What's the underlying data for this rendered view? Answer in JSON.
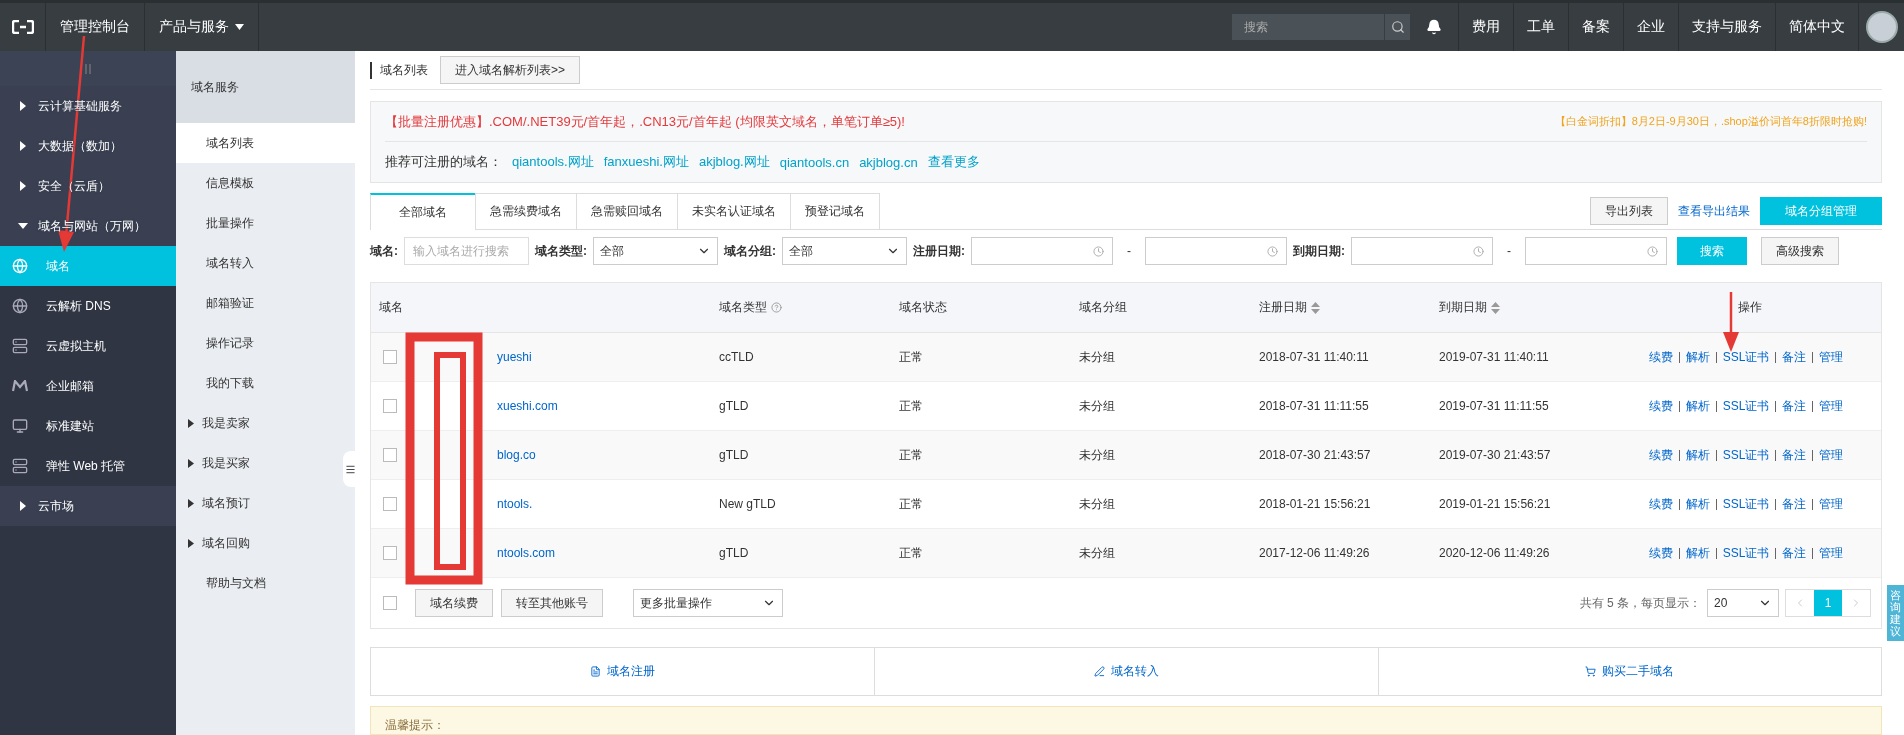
{
  "topbar": {
    "nav": [
      {
        "label": "管理控制台",
        "dropdown": false
      },
      {
        "label": "产品与服务",
        "dropdown": true
      }
    ],
    "search": {
      "placeholder": "搜索"
    },
    "links": [
      "费用",
      "工单",
      "备案",
      "企业",
      "支持与服务",
      "简体中文"
    ]
  },
  "sidebar": {
    "items": [
      {
        "label": "云计算基础服务",
        "kind": "group",
        "expanded": false
      },
      {
        "label": "大数据（数加）",
        "kind": "group",
        "expanded": false
      },
      {
        "label": "安全（云盾）",
        "kind": "group",
        "expanded": false
      },
      {
        "label": "域名与网站（万网）",
        "kind": "group",
        "expanded": true
      },
      {
        "label": "域名",
        "kind": "service",
        "selected": true
      },
      {
        "label": "云解析 DNS",
        "kind": "service",
        "selected": false
      },
      {
        "label": "云虚拟主机",
        "kind": "service",
        "selected": false
      },
      {
        "label": "企业邮箱",
        "kind": "service",
        "selected": false
      },
      {
        "label": "标准建站",
        "kind": "service",
        "selected": false
      },
      {
        "label": "弹性 Web 托管",
        "kind": "service",
        "selected": false
      },
      {
        "label": "云市场",
        "kind": "group",
        "expanded": false
      }
    ]
  },
  "subnav": {
    "title": "域名服务",
    "items": [
      {
        "label": "域名列表",
        "selected": true,
        "expandable": false
      },
      {
        "label": "信息模板",
        "selected": false,
        "expandable": false
      },
      {
        "label": "批量操作",
        "selected": false,
        "expandable": false
      },
      {
        "label": "域名转入",
        "selected": false,
        "expandable": false
      },
      {
        "label": "邮箱验证",
        "selected": false,
        "expandable": false
      },
      {
        "label": "操作记录",
        "selected": false,
        "expandable": false
      },
      {
        "label": "我的下载",
        "selected": false,
        "expandable": false
      },
      {
        "label": "我是卖家",
        "selected": false,
        "expandable": true
      },
      {
        "label": "我是买家",
        "selected": false,
        "expandable": true
      },
      {
        "label": "域名预订",
        "selected": false,
        "expandable": true
      },
      {
        "label": "域名回购",
        "selected": false,
        "expandable": true
      },
      {
        "label": "帮助与文档",
        "selected": false,
        "expandable": false
      }
    ]
  },
  "header": {
    "title": "域名列表",
    "button": "进入域名解析列表>>"
  },
  "promo": {
    "headline": "【批量注册优惠】.COM/.NET39元/首年起，.CN13元/首年起 (均限英文域名，单笔订单≥5)!",
    "side_note": "【白金词折扣】8月2日-9月30日，.shop溢价词首年8折限时抢购!",
    "recommend_label": "推荐可注册的域名：",
    "suggestions": [
      "qiantools.网址",
      "fanxueshi.网址",
      "akjblog.网址",
      "qiantools.cn",
      "akjblog.cn"
    ],
    "more": "查看更多"
  },
  "tabs": [
    {
      "label": "全部域名",
      "selected": true
    },
    {
      "label": "急需续费域名",
      "selected": false
    },
    {
      "label": "急需赎回域名",
      "selected": false
    },
    {
      "label": "未实名认证域名",
      "selected": false
    },
    {
      "label": "预登记域名",
      "selected": false
    }
  ],
  "tab_actions": {
    "export": "导出列表",
    "view_results": "查看导出结果",
    "group_manage": "域名分组管理"
  },
  "filters": [
    {
      "label": "域名:",
      "kind": "text",
      "placeholder": "输入域名进行搜索"
    },
    {
      "label": "域名类型:",
      "kind": "select",
      "value": "全部"
    },
    {
      "label": "域名分组:",
      "kind": "select",
      "value": "全部"
    },
    {
      "label": "注册日期:",
      "kind": "daterange",
      "separator": "-"
    },
    {
      "label": "到期日期:",
      "kind": "daterange",
      "separator": "-"
    }
  ],
  "search_button": "搜索",
  "advanced_button": "高级搜索",
  "table": {
    "columns": [
      {
        "label": "域名",
        "sortable": false,
        "help": false
      },
      {
        "label": "域名类型",
        "sortable": false,
        "help": true
      },
      {
        "label": "域名状态",
        "sortable": false,
        "help": false
      },
      {
        "label": "域名分组",
        "sortable": false,
        "help": false
      },
      {
        "label": "注册日期",
        "sortable": true,
        "help": false
      },
      {
        "label": "到期日期",
        "sortable": true,
        "help": false
      },
      {
        "label": "操作",
        "sortable": false,
        "help": false
      }
    ],
    "rows": [
      {
        "checked": false,
        "domain": "yueshi",
        "type": "ccTLD",
        "status": "正常",
        "group": "未分组",
        "registered": "2018-07-31 11:40:11",
        "expires": "2019-07-31 11:40:11",
        "actions": [
          "续费",
          "解析",
          "SSL证书",
          "备注",
          "管理"
        ]
      },
      {
        "checked": false,
        "domain": "xueshi.com",
        "type": "gTLD",
        "status": "正常",
        "group": "未分组",
        "registered": "2018-07-31 11:11:55",
        "expires": "2019-07-31 11:11:55",
        "actions": [
          "续费",
          "解析",
          "SSL证书",
          "备注",
          "管理"
        ]
      },
      {
        "checked": false,
        "domain": "blog.co",
        "type": "gTLD",
        "status": "正常",
        "group": "未分组",
        "registered": "2018-07-30 21:43:57",
        "expires": "2019-07-30 21:43:57",
        "actions": [
          "续费",
          "解析",
          "SSL证书",
          "备注",
          "管理"
        ]
      },
      {
        "checked": false,
        "domain": "ntools.",
        "type": "New gTLD",
        "status": "正常",
        "group": "未分组",
        "registered": "2018-01-21 15:56:21",
        "expires": "2019-01-21 15:56:21",
        "actions": [
          "续费",
          "解析",
          "SSL证书",
          "备注",
          "管理"
        ]
      },
      {
        "checked": false,
        "domain": "ntools.com",
        "type": "gTLD",
        "status": "正常",
        "group": "未分组",
        "registered": "2017-12-06 11:49:26",
        "expires": "2020-12-06 11:49:26",
        "actions": [
          "续费",
          "解析",
          "SSL证书",
          "备注",
          "管理"
        ]
      }
    ]
  },
  "batch": {
    "checked": false,
    "buttons": [
      "域名续费",
      "转至其他账号"
    ],
    "more": "更多批量操作"
  },
  "pagination": {
    "summary": "共有 5 条，每页显示：",
    "page_size": "20",
    "pages": [
      {
        "label": "1",
        "selected": true
      }
    ]
  },
  "shortcuts": [
    "域名注册",
    "域名转入",
    "购买二手域名"
  ],
  "notice": "温馨提示：",
  "float_tab": "咨询建议"
}
